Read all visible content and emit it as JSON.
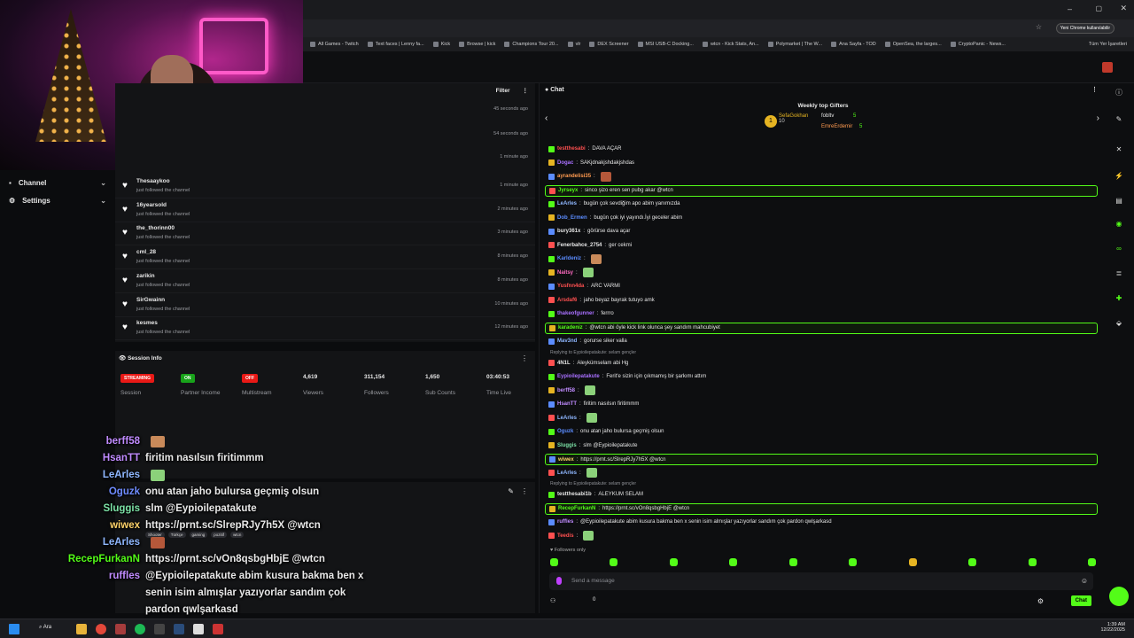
{
  "browser": {
    "profile_button": "Yeni Chrome kullanılabilir",
    "bookmarks": [
      "All Games - Twitch",
      "Text faces | Lenny fa...",
      "Kick",
      "Browse | kick",
      "Champions Tour 20...",
      "vlr",
      "DEX Screener",
      "MSI USB-C Docking...",
      "wtcn - Kick Stats, An...",
      "Polymarket | The W...",
      "Ana Sayfa - TOD",
      "OpenSea, the larges...",
      "CryptoPanic - News..."
    ],
    "all_bookmarks": "Tüm Yer İşaretleri"
  },
  "nav": {
    "channel": "Channel",
    "settings": "Settings"
  },
  "activity": {
    "filter": "Filter",
    "top_times": [
      "45 seconds ago",
      "54 seconds ago",
      "1 minute ago"
    ],
    "items": [
      {
        "name": "Thesaaykoo",
        "sub": "just followed the channel",
        "time": "1 minute ago"
      },
      {
        "name": "16yearsold",
        "sub": "just followed the channel",
        "time": "2 minutes ago"
      },
      {
        "name": "the_thorinn00",
        "sub": "just followed the channel",
        "time": "3 minutes ago"
      },
      {
        "name": "cml_28",
        "sub": "just followed the channel",
        "time": "8 minutes ago"
      },
      {
        "name": "zarikin",
        "sub": "just followed the channel",
        "time": "8 minutes ago"
      },
      {
        "name": "SirGwainn",
        "sub": "just followed the channel",
        "time": "10 minutes ago"
      },
      {
        "name": "kesmes",
        "sub": "just followed the channel",
        "time": "12 minutes ago"
      }
    ]
  },
  "session": {
    "title": "Session Info",
    "stats": [
      {
        "badge": "STREAMING",
        "badge_color": "#e91916",
        "label": "Session"
      },
      {
        "badge": "ON",
        "badge_color": "#18a31a",
        "label": "Partner Income"
      },
      {
        "badge": "OFF",
        "badge_color": "#e91916",
        "label": "Multistream"
      },
      {
        "value": "4,619",
        "label": "Viewers"
      },
      {
        "value": "311,154",
        "label": "Followers"
      },
      {
        "value": "1,650",
        "label": "Sub Counts"
      },
      {
        "value": "03:40:53",
        "label": "Time Live"
      }
    ]
  },
  "stream_tags": [
    "Shooter",
    "Türkçe",
    "gaming",
    "pozitif",
    "wtcn"
  ],
  "overlay": [
    {
      "user": "berff58",
      "text": "",
      "color": "#c08bff"
    },
    {
      "user": "HsanTT",
      "text": "firitim nasılsın firitimmm",
      "color": "#c08bff"
    },
    {
      "user": "LeArles",
      "text": "",
      "color": "#8fb7ff"
    },
    {
      "user": "Oguzk",
      "text": "onu atan jaho bulursa geçmiş olsun",
      "color": "#6f8cff"
    },
    {
      "user": "Sluggis",
      "text": "slm @Eypioilepatakute",
      "color": "#7ce2a6"
    },
    {
      "user": "wiwex",
      "text": "https://prnt.sc/SlrepRJy7h5X @wtcn",
      "color": "#ffd36a"
    },
    {
      "user": "LeArles",
      "text": "",
      "color": "#8fb7ff"
    },
    {
      "user": "RecepFurkanN",
      "text": "https://prnt.sc/vOn8qsbgHbjE @wtcn",
      "color": "#53fc18"
    },
    {
      "user": "ruffles",
      "text": "@Eypioilepatakute abim kusura bakma ben x",
      "color": "#c08bff"
    },
    {
      "user": "",
      "text": "senin isim almışlar yazıyorlar sandım çok",
      "color": "#c08bff"
    },
    {
      "user": "",
      "text": "pardon qwlşarkasd",
      "color": "#c08bff"
    }
  ],
  "chat": {
    "title": "Chat",
    "gifters_title": "Weekly top Gifters",
    "gifters": [
      {
        "name": "SefaGokhan",
        "count": "10"
      },
      {
        "name": "fobltv",
        "count": "5"
      },
      {
        "name": "EmreErdemir",
        "count": "5"
      }
    ],
    "messages": [
      {
        "user": "testthesabi",
        "text": "DAVA AÇAR",
        "color": "#ff5050"
      },
      {
        "user": "Dogac",
        "text": "SAKjdnakjshdakjshdas",
        "color": "#a970ff"
      },
      {
        "user": "ayrandelisi35",
        "text": "",
        "color": "#ff9b50"
      },
      {
        "user": "Jyrseyx",
        "text": "sinco şizo eren sen pubg akar @wtcn",
        "color": "#53fc18",
        "hl": true
      },
      {
        "user": "LeArles",
        "text": "bugün çok sevdiğim apo abim yanımızda",
        "color": "#8fb7ff"
      },
      {
        "user": "Dob_Ermen",
        "text": "bugün çok iyi yayındı.İyi geceler abim",
        "color": "#5b8cff"
      },
      {
        "user": "bury361x",
        "text": "görürse dava açar",
        "color": "#e6e6e6"
      },
      {
        "user": "Fenerbahce_2754",
        "text": "ger cekmi",
        "color": "#e6e6e6"
      },
      {
        "user": "Karldeniz",
        "text": "",
        "color": "#5b8cff"
      },
      {
        "user": "Naitsy",
        "text": "",
        "color": "#ff6ac1"
      },
      {
        "user": "Yusfnn4da",
        "text": "ARC VARMI",
        "color": "#ff5050"
      },
      {
        "user": "Arsdaf6",
        "text": "jaho beyaz bayrak tutuyo amk",
        "color": "#ff5050"
      },
      {
        "user": "thakeofgunner",
        "text": "ferrro",
        "color": "#a970ff"
      },
      {
        "user": "karadeniz",
        "text": "@wtcn abi öyle kick link olunca şey sandım mahcubiyet",
        "color": "#53fc18",
        "hl": true
      },
      {
        "user": "Mav3nd",
        "text": "gorurse siker valla",
        "color": "#8fb7ff"
      },
      {
        "user": "4N1L",
        "text": "Aleykümselam abi Hg",
        "color": "#e6e6e6",
        "reply": "Replying to Eypioilepatakute: selam gençler"
      },
      {
        "user": "Eypioilepatakute",
        "text": "Ferit'e sizin için çıkmamış bir şarkımı attım",
        "color": "#a970ff"
      },
      {
        "user": "berff58",
        "text": "",
        "color": "#c08bff"
      },
      {
        "user": "HsanTT",
        "text": "firitim nasılsın firitimmm",
        "color": "#c08bff"
      },
      {
        "user": "LeArles",
        "text": "",
        "color": "#8fb7ff"
      },
      {
        "user": "Oguzk",
        "text": "onu atan jaho bulursa geçmiş olsun",
        "color": "#5b8cff"
      },
      {
        "user": "Sluggis",
        "text": "slm @Eypioilepatakute",
        "color": "#7ce2a6"
      },
      {
        "user": "wiwex",
        "text": "https://prnt.sc/SlrepRJy7h5X @wtcn",
        "color": "#ffd36a",
        "hl": true
      },
      {
        "user": "LeArles",
        "text": "",
        "color": "#8fb7ff"
      },
      {
        "user": "testthesabi1b",
        "text": "ALEYKUM SELAM",
        "color": "#e6e6e6",
        "reply": "Replying to Eypioilepatakute: selam gençler"
      },
      {
        "user": "RecepFurkanN",
        "text": "https://prnt.sc/vOn8qsbgHbjE @wtcn",
        "color": "#53fc18",
        "hl": true
      },
      {
        "user": "ruffles",
        "text": "@Eypioilepatakute abim kusura bakma ben x senin isim almışlar yazıyorlar sandım çok pardon qwlşarkasd",
        "color": "#c08bff"
      },
      {
        "user": "Teedis",
        "text": "",
        "color": "#ff5050"
      }
    ],
    "followers_only": "Followers only",
    "placeholder": "Send a message",
    "viewer_count": "0",
    "send": "Chat"
  },
  "taskbar": {
    "search": "Ara",
    "time": "1:39 AM",
    "date": "12/22/2025"
  }
}
